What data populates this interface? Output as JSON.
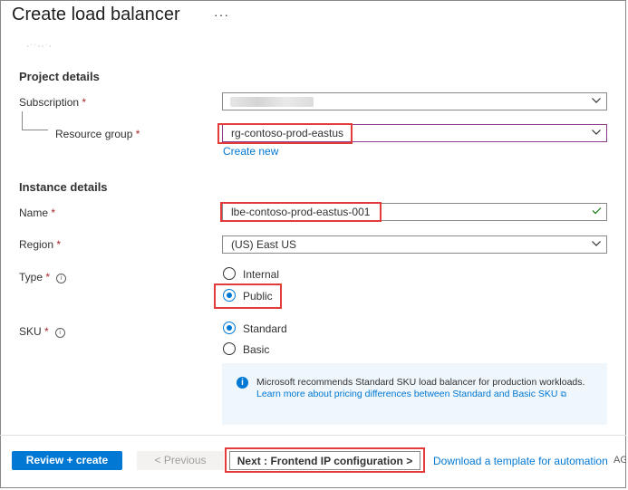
{
  "header": {
    "title": "Create load balancer",
    "more_label": "···"
  },
  "clipped_text": "‚ ·  ·  ,  ,  ·  ,",
  "project": {
    "heading": "Project details",
    "subscription_label": "Subscription",
    "resource_group_label": "Resource group",
    "resource_group_value": "rg-contoso-prod-eastus",
    "create_new": "Create new"
  },
  "instance": {
    "heading": "Instance details",
    "name_label": "Name",
    "name_value": "lbe-contoso-prod-eastus-001",
    "region_label": "Region",
    "region_value": "(US) East US",
    "type_label": "Type",
    "type_options": [
      "Internal",
      "Public"
    ],
    "type_selected": "Public",
    "sku_label": "SKU",
    "sku_options": [
      "Standard",
      "Basic"
    ],
    "sku_selected": "Standard"
  },
  "required_marker": "*",
  "info_message": {
    "text": "Microsoft recommends Standard SKU load balancer for production workloads.",
    "link": "Learn more about pricing differences between Standard and Basic SKU"
  },
  "footer": {
    "review_create": "Review + create",
    "previous": "< Previous",
    "next": "Next : Frontend IP configuration >",
    "download": "Download a template for automation",
    "cut_off": "AG"
  },
  "colors": {
    "accent": "#0078d4",
    "highlight": "#e33a3a",
    "valid": "#107c10"
  }
}
